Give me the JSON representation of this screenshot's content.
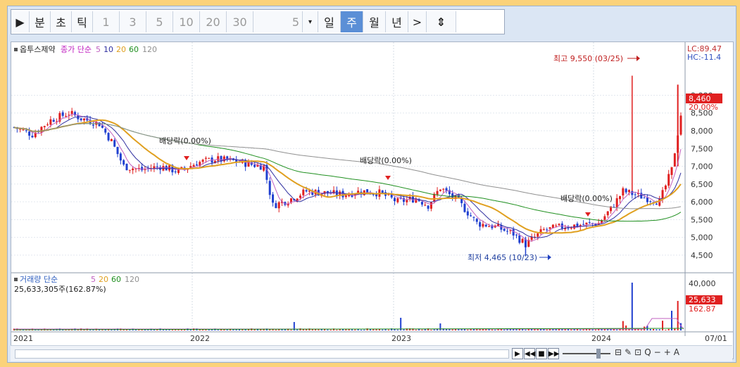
{
  "toolbar": {
    "play": "▶",
    "periods": [
      "분",
      "초",
      "틱"
    ],
    "intervals": [
      "1",
      "3",
      "5",
      "10",
      "20",
      "30"
    ],
    "combo_value": "5",
    "combo_arrow": "▾",
    "units": [
      "일",
      "주",
      "월",
      "년"
    ],
    "selected_unit": "주",
    "next": ">",
    "expand_icon": "⇕"
  },
  "chart_data": {
    "type": "candlestick",
    "title": "옵투스제약",
    "price_legend": {
      "prefix": "종가 단순",
      "periods": [
        "5",
        "10",
        "20",
        "60",
        "120"
      ],
      "colors": [
        "#c060c0",
        "#3030a0",
        "#e0a020",
        "#209020",
        "#909090"
      ]
    },
    "volume_legend": {
      "prefix": "거래량 단순",
      "periods": [
        "5",
        "20",
        "60",
        "120"
      ],
      "colors": [
        "#c060c0",
        "#e0a020",
        "#209020",
        "#909090"
      ]
    },
    "volume_value": "25,633,305주(162.87%)",
    "price_axis": {
      "ticks": [
        4500,
        5000,
        5500,
        6000,
        6500,
        7000,
        7500,
        8000,
        8500,
        9000
      ],
      "labels": [
        "4,500",
        "5,000",
        "5,500",
        "6,000",
        "6,500",
        "7,000",
        "7,500",
        "8,000",
        "8,500",
        "9,000"
      ],
      "ylim": [
        4200,
        9900
      ]
    },
    "axis_flags": {
      "lc": "LC:89.47",
      "hc": "HC:-11.4",
      "current": "8,460",
      "pct": "20.00%"
    },
    "volume_axis": {
      "label": "40,000",
      "current": "25,633",
      "pct": "162.87"
    },
    "x_axis": {
      "labels": [
        "2021",
        "2022",
        "2023",
        "2024",
        "07/01"
      ]
    },
    "annotations": {
      "high": "최고 9,550 (03/25)",
      "low": "최저 4,465 (10/23)",
      "dividend": [
        "배당락(0.00%)",
        "배당락(0.00%)",
        "배당락(0.00%)"
      ]
    },
    "trend_points": [
      {
        "t": 0,
        "p": 8100
      },
      {
        "t": 6,
        "p": 7900
      },
      {
        "t": 12,
        "p": 8300
      },
      {
        "t": 18,
        "p": 8500
      },
      {
        "t": 22,
        "p": 8350
      },
      {
        "t": 28,
        "p": 8200
      },
      {
        "t": 32,
        "p": 7700
      },
      {
        "t": 36,
        "p": 7000
      },
      {
        "t": 42,
        "p": 6900
      },
      {
        "t": 48,
        "p": 7000
      },
      {
        "t": 54,
        "p": 6850
      },
      {
        "t": 60,
        "p": 7100
      },
      {
        "t": 66,
        "p": 7200
      },
      {
        "t": 72,
        "p": 7150
      },
      {
        "t": 78,
        "p": 7050
      },
      {
        "t": 82,
        "p": 7000
      },
      {
        "t": 85,
        "p": 5900
      },
      {
        "t": 90,
        "p": 6050
      },
      {
        "t": 96,
        "p": 6300
      },
      {
        "t": 102,
        "p": 6250
      },
      {
        "t": 108,
        "p": 6200
      },
      {
        "t": 114,
        "p": 6300
      },
      {
        "t": 120,
        "p": 6250
      },
      {
        "t": 126,
        "p": 6000
      },
      {
        "t": 132,
        "p": 6100
      },
      {
        "t": 136,
        "p": 5900
      },
      {
        "t": 140,
        "p": 6400
      },
      {
        "t": 146,
        "p": 6000
      },
      {
        "t": 152,
        "p": 5400
      },
      {
        "t": 158,
        "p": 5300
      },
      {
        "t": 164,
        "p": 5100
      },
      {
        "t": 168,
        "p": 4800
      },
      {
        "t": 174,
        "p": 5200
      },
      {
        "t": 180,
        "p": 5300
      },
      {
        "t": 186,
        "p": 5350
      },
      {
        "t": 192,
        "p": 5400
      },
      {
        "t": 196,
        "p": 5800
      },
      {
        "t": 200,
        "p": 6300
      },
      {
        "t": 204,
        "p": 6200
      },
      {
        "t": 208,
        "p": 6100
      },
      {
        "t": 212,
        "p": 6000
      },
      {
        "t": 216,
        "p": 6900
      },
      {
        "t": 219,
        "p": 8460
      }
    ]
  },
  "scrollbar": {
    "buttons": [
      "▶",
      "◀◀",
      "■",
      "▶▶"
    ],
    "tools": [
      "⊟",
      "✎",
      "⊡",
      "Q",
      "−",
      "+",
      "A"
    ]
  }
}
